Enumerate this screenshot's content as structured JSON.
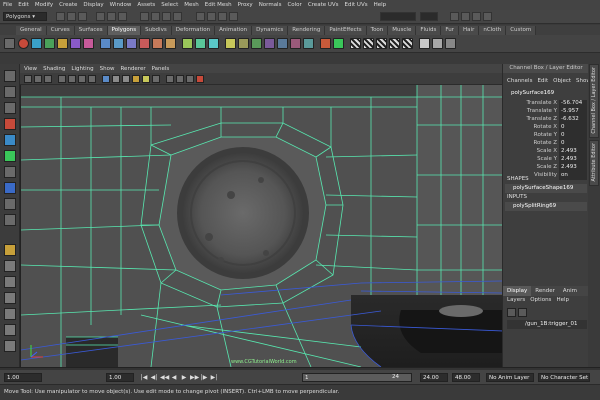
{
  "menubar": {
    "items": [
      "File",
      "Edit",
      "Modify",
      "Create",
      "Display",
      "Window",
      "Assets",
      "Select",
      "Mesh",
      "Edit Mesh",
      "Proxy",
      "Normals",
      "Color",
      "Create UVs",
      "Edit UVs",
      "Help"
    ]
  },
  "statusline": {
    "mode": "Polygons"
  },
  "shelf_tabs": {
    "items": [
      "General",
      "Curves",
      "Surfaces",
      "Polygons",
      "Subdivs",
      "Deformation",
      "Animation",
      "Dynamics",
      "Rendering",
      "PaintEffects",
      "Toon",
      "Muscle",
      "Fluids",
      "Fur",
      "Hair",
      "nCloth",
      "Custom"
    ],
    "active": "Polygons"
  },
  "panel_menu": {
    "items": [
      "View",
      "Shading",
      "Lighting",
      "Show",
      "Renderer",
      "Panels"
    ]
  },
  "viewport": {
    "watermark": "www.CGTutorialWorld.com"
  },
  "channel_box": {
    "title": "Channel Box / Layer Editor",
    "tabs": [
      "Channels",
      "Edit",
      "Object",
      "Show"
    ],
    "object_name": "polySurface169",
    "attributes": [
      {
        "name": "Translate X",
        "value": "-56.704"
      },
      {
        "name": "Translate Y",
        "value": "-5.957"
      },
      {
        "name": "Translate Z",
        "value": "-6.632"
      },
      {
        "name": "Rotate X",
        "value": "0"
      },
      {
        "name": "Rotate Y",
        "value": "0"
      },
      {
        "name": "Rotate Z",
        "value": "0"
      },
      {
        "name": "Scale X",
        "value": "2.493"
      },
      {
        "name": "Scale Y",
        "value": "2.493"
      },
      {
        "name": "Scale Z",
        "value": "2.493"
      },
      {
        "name": "Visibility",
        "value": "on"
      }
    ],
    "shapes_label": "SHAPES",
    "shape_name": "polySurfaceShape169",
    "inputs_label": "INPUTS",
    "input_name": "polySplitRing69"
  },
  "layer_editor": {
    "tabs": [
      "Display",
      "Render",
      "Anim"
    ],
    "active_tab": "Display",
    "menu": [
      "Layers",
      "Options",
      "Help"
    ],
    "layer_name": "/gun_1B:trigger_01"
  },
  "side_tabs": [
    "Channel Box / Layer Editor",
    "Attribute Editor"
  ],
  "range": {
    "start": "1.00",
    "current_left": "1.00",
    "range_start": "1",
    "range_end": "24",
    "end_a": "24.00",
    "end_b": "48.00",
    "current_right": "1.00",
    "anim_layer": "No Anim Layer",
    "char_set": "No Character Set"
  },
  "playback": [
    "|◀",
    "◀|",
    "◀◀",
    "◀",
    "▶",
    "▶▶",
    "|▶",
    "▶|"
  ],
  "helpline": {
    "text": "Move Tool: Use manipulator to move object(s). Use edit mode to change pivot (INSERT). Ctrl+LMB to move perpendicular."
  },
  "colors": {
    "wire": "#58e8b0",
    "wire_blue": "#3a5ad8",
    "surface": "#4f4f4f",
    "ui_bg": "#3a3a3a",
    "accent_selected": "#5e5e5e"
  }
}
